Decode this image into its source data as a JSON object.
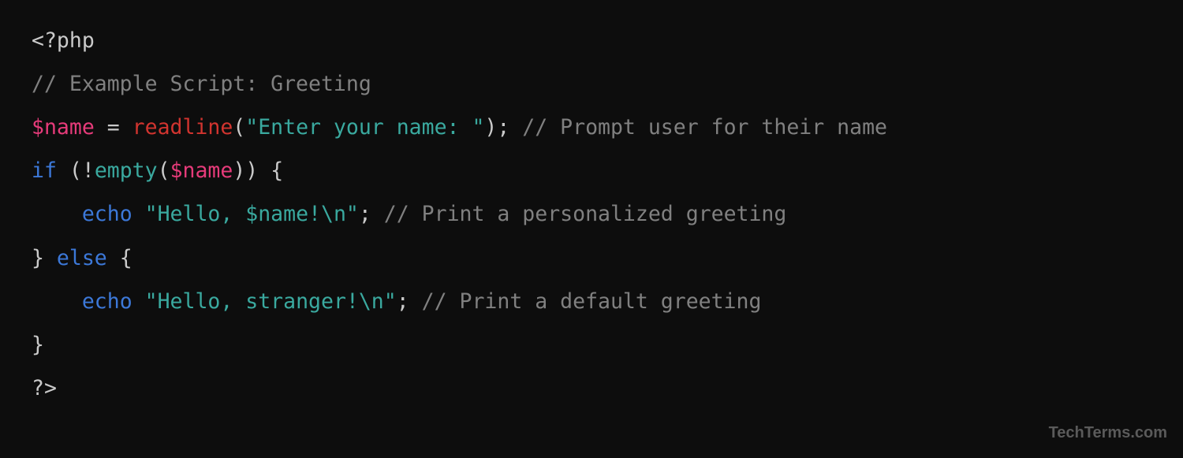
{
  "code": {
    "l1_open": "<?php",
    "l2_comment": "// Example Script: Greeting",
    "l3_var": "$name",
    "l3_eq": " = ",
    "l3_fn": "readline",
    "l3_p1": "(",
    "l3_str": "\"Enter your name: \"",
    "l3_p2": ");",
    "l3_sp": " ",
    "l3_cmt": "// Prompt user for their name",
    "l4_if": "if",
    "l4_sp": " ",
    "l4_p1": "(!",
    "l4_emp": "empty",
    "l4_p2": "(",
    "l4_var": "$name",
    "l4_p3": ")) {",
    "l5_ind": "    ",
    "l5_echo": "echo",
    "l5_sp": " ",
    "l5_str": "\"Hello, $name!\\n\"",
    "l5_semi": ";",
    "l5_sp2": " ",
    "l5_cmt": "// Print a personalized greeting",
    "l6_close": "} ",
    "l6_else": "else",
    "l6_open": " {",
    "l7_ind": "    ",
    "l7_echo": "echo",
    "l7_sp": " ",
    "l7_str": "\"Hello, stranger!\\n\"",
    "l7_semi": ";",
    "l7_sp2": " ",
    "l7_cmt": "// Print a default greeting",
    "l8_close": "}",
    "l9_close": "?>"
  },
  "watermark": "TechTerms.com"
}
